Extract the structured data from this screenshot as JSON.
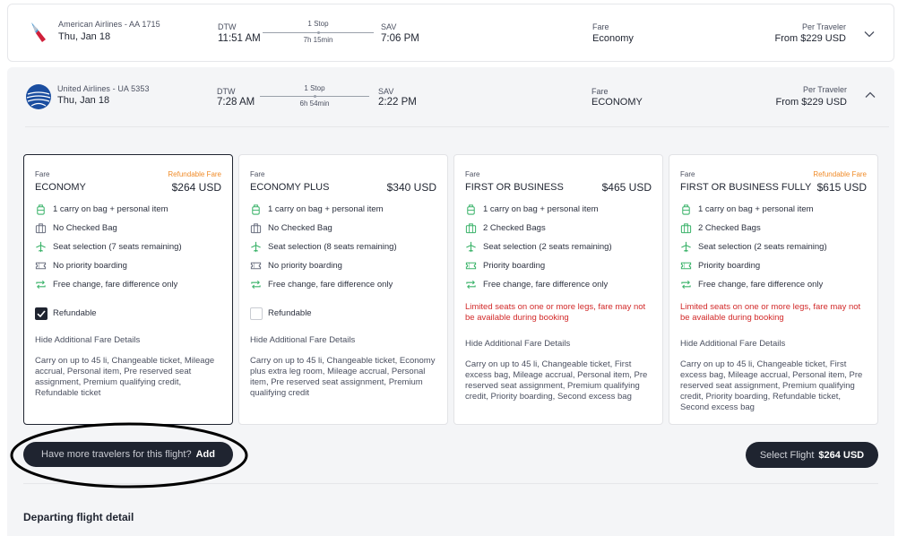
{
  "flights": [
    {
      "airline": "American Airlines - AA 1715",
      "date": "Thu, Jan 18",
      "origin": "DTW",
      "depart_time": "11:51 AM",
      "stops": "1 Stop",
      "duration": "7h 15min",
      "destination": "SAV",
      "arrive_time": "7:06 PM",
      "fare_label": "Fare",
      "fare": "Economy",
      "per_traveler_label": "Per Traveler",
      "price": "From $229 USD",
      "icon": "chevron-down-icon"
    },
    {
      "airline": "United Airlines - UA 5353",
      "date": "Thu, Jan 18",
      "origin": "DTW",
      "depart_time": "7:28 AM",
      "stops": "1 Stop",
      "duration": "6h 54min",
      "destination": "SAV",
      "arrive_time": "2:22 PM",
      "fare_label": "Fare",
      "fare": "ECONOMY",
      "per_traveler_label": "Per Traveler",
      "price": "From $229 USD",
      "icon": "chevron-up-icon"
    }
  ],
  "fare_options": [
    {
      "fare_label": "Fare",
      "refundable_badge": "Refundable Fare",
      "name": "ECONOMY",
      "price": "$264 USD",
      "features": [
        "1 carry on bag + personal item",
        "No Checked Bag",
        "Seat selection (7 seats remaining)",
        "No priority boarding",
        "Free change, fare difference only"
      ],
      "refundable_label": "Refundable",
      "refundable_checked": true,
      "hide_details": "Hide Additional Fare Details",
      "details": "Carry on up to 45 li, Changeable ticket, Mileage accrual, Personal item, Pre reserved seat assignment, Premium qualifying credit, Refundable ticket"
    },
    {
      "fare_label": "Fare",
      "refundable_badge": "",
      "name": "ECONOMY PLUS",
      "price": "$340 USD",
      "features": [
        "1 carry on bag + personal item",
        "No Checked Bag",
        "Seat selection (8 seats remaining)",
        "No priority boarding",
        "Free change, fare difference only"
      ],
      "refundable_label": "Refundable",
      "refundable_checked": false,
      "hide_details": "Hide Additional Fare Details",
      "details": "Carry on up to 45 li, Changeable ticket, Economy plus extra leg room, Mileage accrual, Personal item, Pre reserved seat assignment, Premium qualifying credit"
    },
    {
      "fare_label": "Fare",
      "refundable_badge": "",
      "name": "FIRST OR BUSINESS",
      "price": "$465 USD",
      "features": [
        "1 carry on bag + personal item",
        "2 Checked Bags",
        "Seat selection (2 seats remaining)",
        "Priority boarding",
        "Free change, fare difference only"
      ],
      "warning": "Limited seats on one or more legs, fare may not be available during booking",
      "hide_details": "Hide Additional Fare Details",
      "details": "Carry on up to 45 li, Changeable ticket, First excess bag, Mileage accrual, Personal item, Pre reserved seat assignment, Premium qualifying credit, Priority boarding, Second excess bag"
    },
    {
      "fare_label": "Fare",
      "refundable_badge": "Refundable Fare",
      "name": "FIRST OR BUSINESS FULLY",
      "price": "$615 USD",
      "features": [
        "1 carry on bag + personal item",
        "2 Checked Bags",
        "Seat selection (2 seats remaining)",
        "Priority boarding",
        "Free change, fare difference only"
      ],
      "warning": "Limited seats on one or more legs, fare may not be available during booking",
      "hide_details": "Hide Additional Fare Details",
      "details": "Carry on up to 45 li, Changeable ticket, First excess bag, Mileage accrual, Personal item, Pre reserved seat assignment, Premium qualifying credit, Priority boarding, Refundable ticket, Second excess bag"
    }
  ],
  "feature_icons": [
    "carry-on-bag-icon",
    "checked-bag-icon",
    "seat-icon",
    "boarding-pass-icon",
    "change-arrows-icon"
  ],
  "more_travelers": {
    "text": "Have more travelers for this flight?",
    "action": "Add"
  },
  "select_flight": {
    "text": "Select Flight",
    "price": "$264 USD"
  },
  "departing_title": "Departing flight detail",
  "colors": {
    "accent_dark": "#1f2430",
    "feature_green": "#3bb36a",
    "refundable_orange": "#f08c2a",
    "warning_red": "#d22a2a"
  }
}
